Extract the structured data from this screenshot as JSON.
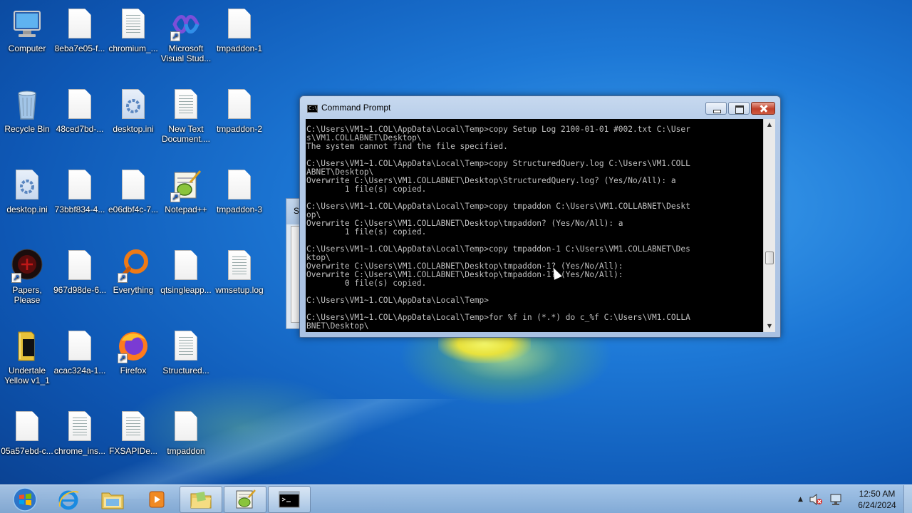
{
  "desktop": {
    "icons": [
      {
        "label": "Computer",
        "icon": "computer-icon"
      },
      {
        "label": "8eba7e05-f...",
        "icon": "file-icon"
      },
      {
        "label": "chromium_...",
        "icon": "file-icon"
      },
      {
        "label": "Microsoft Visual Stud...",
        "icon": "visual-studio-icon"
      },
      {
        "label": "tmpaddon-1",
        "icon": "file-icon"
      },
      {
        "label": "Recycle Bin",
        "icon": "recycle-bin-icon"
      },
      {
        "label": "48ced7bd-...",
        "icon": "file-icon"
      },
      {
        "label": "desktop.ini",
        "icon": "settings-file-icon"
      },
      {
        "label": "New Text Document....",
        "icon": "text-file-icon"
      },
      {
        "label": "tmpaddon-2",
        "icon": "file-icon"
      },
      {
        "label": "desktop.ini",
        "icon": "settings-file-icon"
      },
      {
        "label": "73bbf834-4...",
        "icon": "file-icon"
      },
      {
        "label": "e06dbf4c-7...",
        "icon": "file-icon"
      },
      {
        "label": "Notepad++",
        "icon": "notepadpp-icon"
      },
      {
        "label": "tmpaddon-3",
        "icon": "file-icon"
      },
      {
        "label": "Papers, Please",
        "icon": "papers-please-icon"
      },
      {
        "label": "967d98de-6...",
        "icon": "file-icon"
      },
      {
        "label": "Everything",
        "icon": "everything-search-icon"
      },
      {
        "label": "qtsingleapp...",
        "icon": "file-icon"
      },
      {
        "label": "wmsetup.log",
        "icon": "text-file-icon"
      },
      {
        "label": "Undertale Yellow v1_1",
        "icon": "folder-icon"
      },
      {
        "label": "acac324a-1...",
        "icon": "file-icon"
      },
      {
        "label": "Firefox",
        "icon": "firefox-icon"
      },
      {
        "label": "Structured...",
        "icon": "text-file-icon"
      },
      {
        "label": "05a57ebd-c...",
        "icon": "file-icon"
      },
      {
        "label": "chrome_ins...",
        "icon": "text-file-icon"
      },
      {
        "label": "FXSAPIDe...",
        "icon": "text-file-icon"
      },
      {
        "label": "tmpaddon",
        "icon": "file-icon"
      }
    ]
  },
  "background_window": {
    "title_initial": "S"
  },
  "cmd_window": {
    "title": "Command Prompt",
    "title_icon_text": "C:\\",
    "lines": [
      "C:\\Users\\VM1~1.COL\\AppData\\Local\\Temp>copy Setup Log 2100-01-01 #002.txt C:\\User",
      "s\\VM1.COLLABNET\\Desktop\\",
      "The system cannot find the file specified.",
      "",
      "C:\\Users\\VM1~1.COL\\AppData\\Local\\Temp>copy StructuredQuery.log C:\\Users\\VM1.COLL",
      "ABNET\\Desktop\\",
      "Overwrite C:\\Users\\VM1.COLLABNET\\Desktop\\StructuredQuery.log? (Yes/No/All): a",
      "        1 file(s) copied.",
      "",
      "C:\\Users\\VM1~1.COL\\AppData\\Local\\Temp>copy tmpaddon C:\\Users\\VM1.COLLABNET\\Deskt",
      "op\\",
      "Overwrite C:\\Users\\VM1.COLLABNET\\Desktop\\tmpaddon? (Yes/No/All): a",
      "        1 file(s) copied.",
      "",
      "C:\\Users\\VM1~1.COL\\AppData\\Local\\Temp>copy tmpaddon-1 C:\\Users\\VM1.COLLABNET\\Des",
      "ktop\\",
      "Overwrite C:\\Users\\VM1.COLLABNET\\Desktop\\tmpaddon-1? (Yes/No/All):",
      "Overwrite C:\\Users\\VM1.COLLABNET\\Desktop\\tmpaddon-1? (Yes/No/All):",
      "        0 file(s) copied.",
      "",
      "C:\\Users\\VM1~1.COL\\AppData\\Local\\Temp>",
      "",
      "C:\\Users\\VM1~1.COL\\AppData\\Local\\Temp>for %f in (*.*) do c_%f C:\\Users\\VM1.COLLA",
      "BNET\\Desktop\\"
    ]
  },
  "taskbar": {
    "buttons": [
      {
        "name": "internet-explorer-icon"
      },
      {
        "name": "file-explorer-icon"
      },
      {
        "name": "media-player-icon"
      },
      {
        "name": "folder-icon"
      },
      {
        "name": "notepadpp-icon"
      },
      {
        "name": "command-prompt-icon"
      }
    ],
    "clock_time": "12:50 AM",
    "clock_date": "6/24/2024"
  }
}
